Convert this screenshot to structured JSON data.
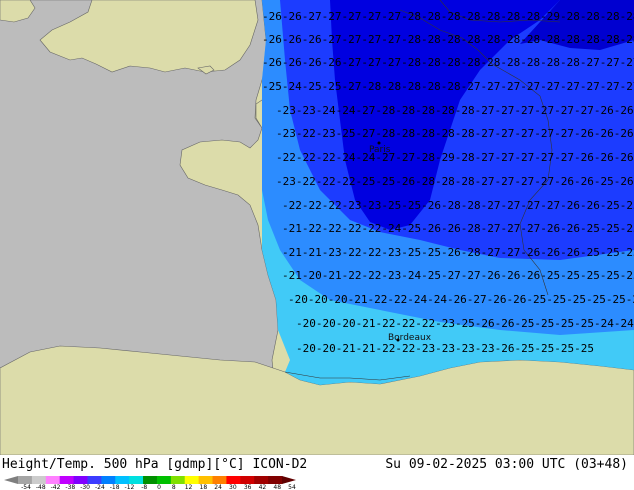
{
  "title_left": "Height/Temp. 500 hPa [gdmp][°C] ICON-D2",
  "title_right": "Su 09-02-2025 03:00 UTC (03+48)",
  "cities": {
    "paris": "Paris",
    "bordeaux": "Bordeaux"
  },
  "contour_rows": [
    "2626272727272728282828282828292828282827",
    "2626262727272728282828282828282828282828",
    "26262626272727282828282828282828272727",
    "25242525272828282828272727272727272727",
    "23232424272828282828272727272727262626",
    "23222325272828282828272727272726262626",
    "22222224242727282928272727272726262625",
    "23222222252526282828272727272626252626",
    "22222223232525262828272727272626252525",
    "21222222222425262628272727262625252525",
    "21212322222325252628272726262625252525",
    "21202122222324252727262626252525252525",
    "20202021222224242627262625252525252424",
    "2020202122222223252626252525252424",
    "202021212222232323232625252525"
  ],
  "colors": {
    "ocean": "#bcbcbc",
    "land": "#dcdcaa",
    "deep_blue": "#0000e0",
    "mid_blue": "#1c3cff",
    "light_blue": "#2c8cff",
    "cyan": "#30c8ff"
  },
  "legend": {
    "colors": [
      "#7f7f7f",
      "#a5a5a5",
      "#cccccc",
      "#ff80ff",
      "#c000ff",
      "#8000ff",
      "#3c3cff",
      "#0080ff",
      "#00c0ff",
      "#00e0e0",
      "#009000",
      "#00c000",
      "#80e000",
      "#ffff00",
      "#ffc000",
      "#ff8000",
      "#ff0000",
      "#d00000",
      "#a00000",
      "#800000",
      "#600000"
    ],
    "ticks": [
      "-54",
      "-48",
      "-42",
      "-38",
      "-30",
      "-24",
      "-18",
      "-12",
      "-8",
      "0",
      "8",
      "12",
      "18",
      "24",
      "30",
      "36",
      "42",
      "48",
      "54"
    ]
  }
}
